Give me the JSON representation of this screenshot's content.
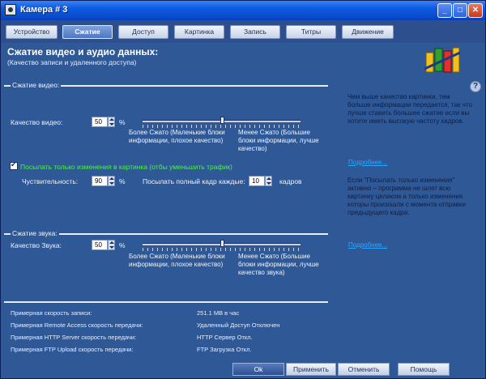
{
  "window": {
    "title": "Камера # 3"
  },
  "tabs": [
    {
      "label": "Устройство"
    },
    {
      "label": "Сжатие"
    },
    {
      "label": "Доступ"
    },
    {
      "label": "Картинка"
    },
    {
      "label": "Запись"
    },
    {
      "label": "Титры"
    },
    {
      "label": "Движение"
    }
  ],
  "header": {
    "title": "Сжатие видео и аудио данных:",
    "subtitle": "(Качество записи и удаленного доступа)"
  },
  "video": {
    "section": "Сжатие видео:",
    "quality_label": "Качество видео:",
    "quality_value": "50",
    "percent": "%",
    "quality_level": 0.5,
    "left_caption": "Более Сжато (Маленькие блоки информации, плохое качество)",
    "right_caption": "Менее Сжато (Большие блоки информации, лучше качество)",
    "changes_checkbox": "Посылать только изменения в картинка (отбы уменьшить трафик)",
    "changes_checked": true,
    "sensitivity_label": "Чуствительность:",
    "sensitivity_value": "90",
    "keyframe_label": "Посылать полный кадр каждые:",
    "keyframe_value": "10",
    "frames_label": "кадров"
  },
  "info": {
    "text1": "Чем выше качество картинки, тем больше информации передается, так что лучше ставить большее сжатие если вы хотите иметь высокую частоту кадров.",
    "link1": "Подробнее...",
    "text2": "Если \"Посылать только изменения\" активно – программа не шлет всю картинку целиком а только изменения которы произошли с момента отправки предыдущего кадра.",
    "link2": "Подробнее..."
  },
  "audio": {
    "section": "Сжатие звука:",
    "quality_label": "Качество Звука:",
    "quality_value": "50",
    "percent": "%",
    "quality_level": 0.5,
    "left_caption": "Более Сжато (Маленькие блоки информации, плохое качество)",
    "right_caption": "Менее Сжато (Большие блоки информации, лучше качество звука)"
  },
  "stats": [
    {
      "label": "Примерная скорость записи:",
      "value": "251.1 MB в час"
    },
    {
      "label": "Примерная Remote Access скорость передачи:",
      "value": "Удаленный Доступ Отключен"
    },
    {
      "label": "Примерная HTTP Server скорость передачи:",
      "value": "HTTP Сервер Откл."
    },
    {
      "label": "Примерная FTP Upload скорость передачи:",
      "value": "FTP Загрузка Откл."
    }
  ],
  "buttons": {
    "ok": "Ok",
    "apply": "Применить",
    "cancel": "Отменить",
    "help": "Помощь"
  },
  "colors": {
    "background": "#2f5897",
    "title_bar": "#0c5ae0",
    "green_text": "#4df04d",
    "link": "#2aa8ff"
  }
}
